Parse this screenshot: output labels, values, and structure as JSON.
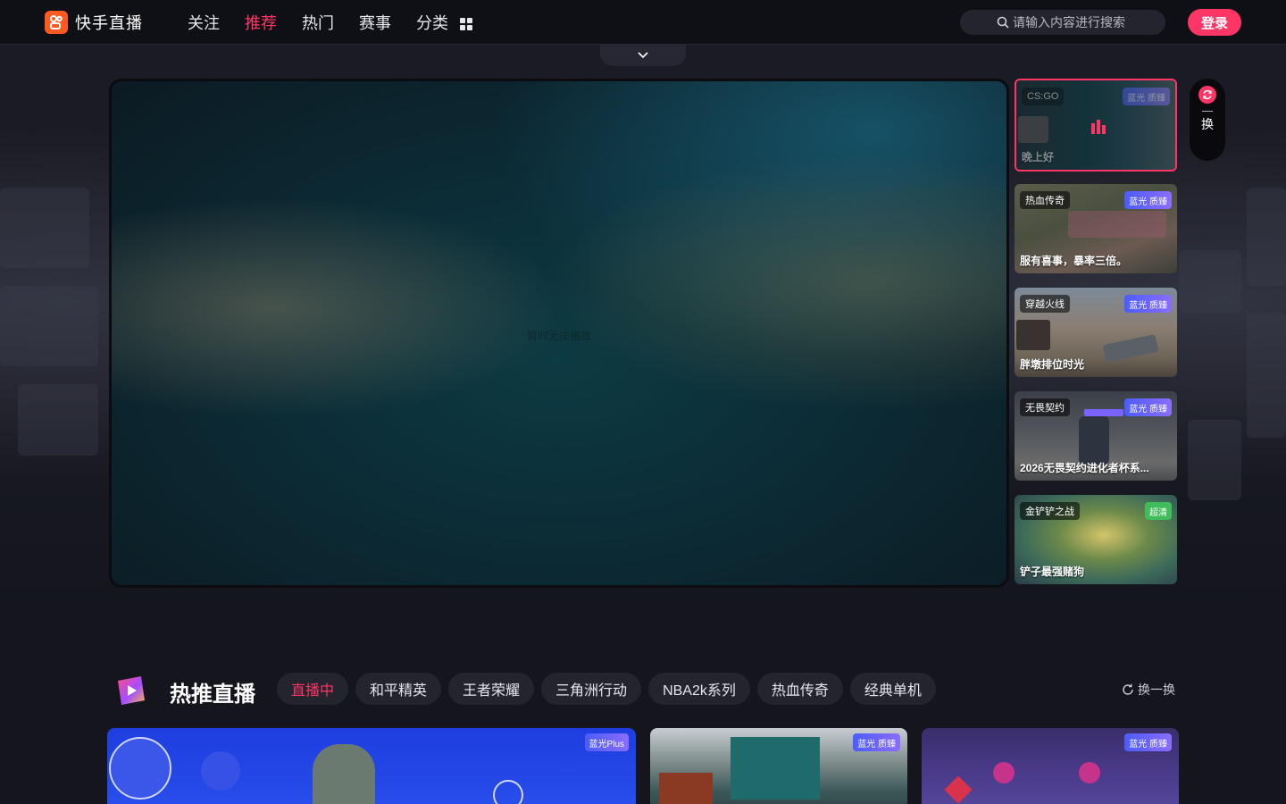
{
  "header": {
    "logo_text": "快手直播",
    "nav": [
      {
        "label": "关注",
        "active": false
      },
      {
        "label": "推荐",
        "active": true
      },
      {
        "label": "热门",
        "active": false
      },
      {
        "label": "赛事",
        "active": false
      },
      {
        "label": "分类",
        "active": false
      }
    ],
    "search_placeholder": "请输入内容进行搜索",
    "login_label": "登录"
  },
  "player": {
    "message": "暂时无法播放"
  },
  "side_list": [
    {
      "category": "CS:GO",
      "quality": "蓝光 质臻",
      "title": "晚上好",
      "active": true
    },
    {
      "category": "热血传奇",
      "quality": "蓝光 质臻",
      "title": "服有喜事，暴率三倍。",
      "active": false
    },
    {
      "category": "穿越火线",
      "quality": "蓝光 质臻",
      "title": "胖墩排位时光",
      "active": false
    },
    {
      "category": "无畏契约",
      "quality": "蓝光 质臻",
      "title": "2026无畏契约进化者杯系...",
      "active": false
    },
    {
      "category": "金铲铲之战",
      "quality": "超清",
      "title": "铲子最强赌狗",
      "active": false
    }
  ],
  "swap": {
    "label": "换"
  },
  "hot": {
    "title": "热推直播",
    "tabs": [
      {
        "label": "直播中",
        "active": true
      },
      {
        "label": "和平精英",
        "active": false
      },
      {
        "label": "王者荣耀",
        "active": false
      },
      {
        "label": "三角洲行动",
        "active": false
      },
      {
        "label": "NBA2k系列",
        "active": false
      },
      {
        "label": "热血传奇",
        "active": false
      },
      {
        "label": "经典单机",
        "active": false
      }
    ],
    "refresh_label": "换一换",
    "cards": [
      {
        "quality": "蓝光Plus"
      },
      {
        "quality": "蓝光 质臻"
      },
      {
        "quality": "蓝光 质臻"
      }
    ]
  },
  "colors": {
    "accent": "#fe3666",
    "brand": "#ff5a1f"
  }
}
